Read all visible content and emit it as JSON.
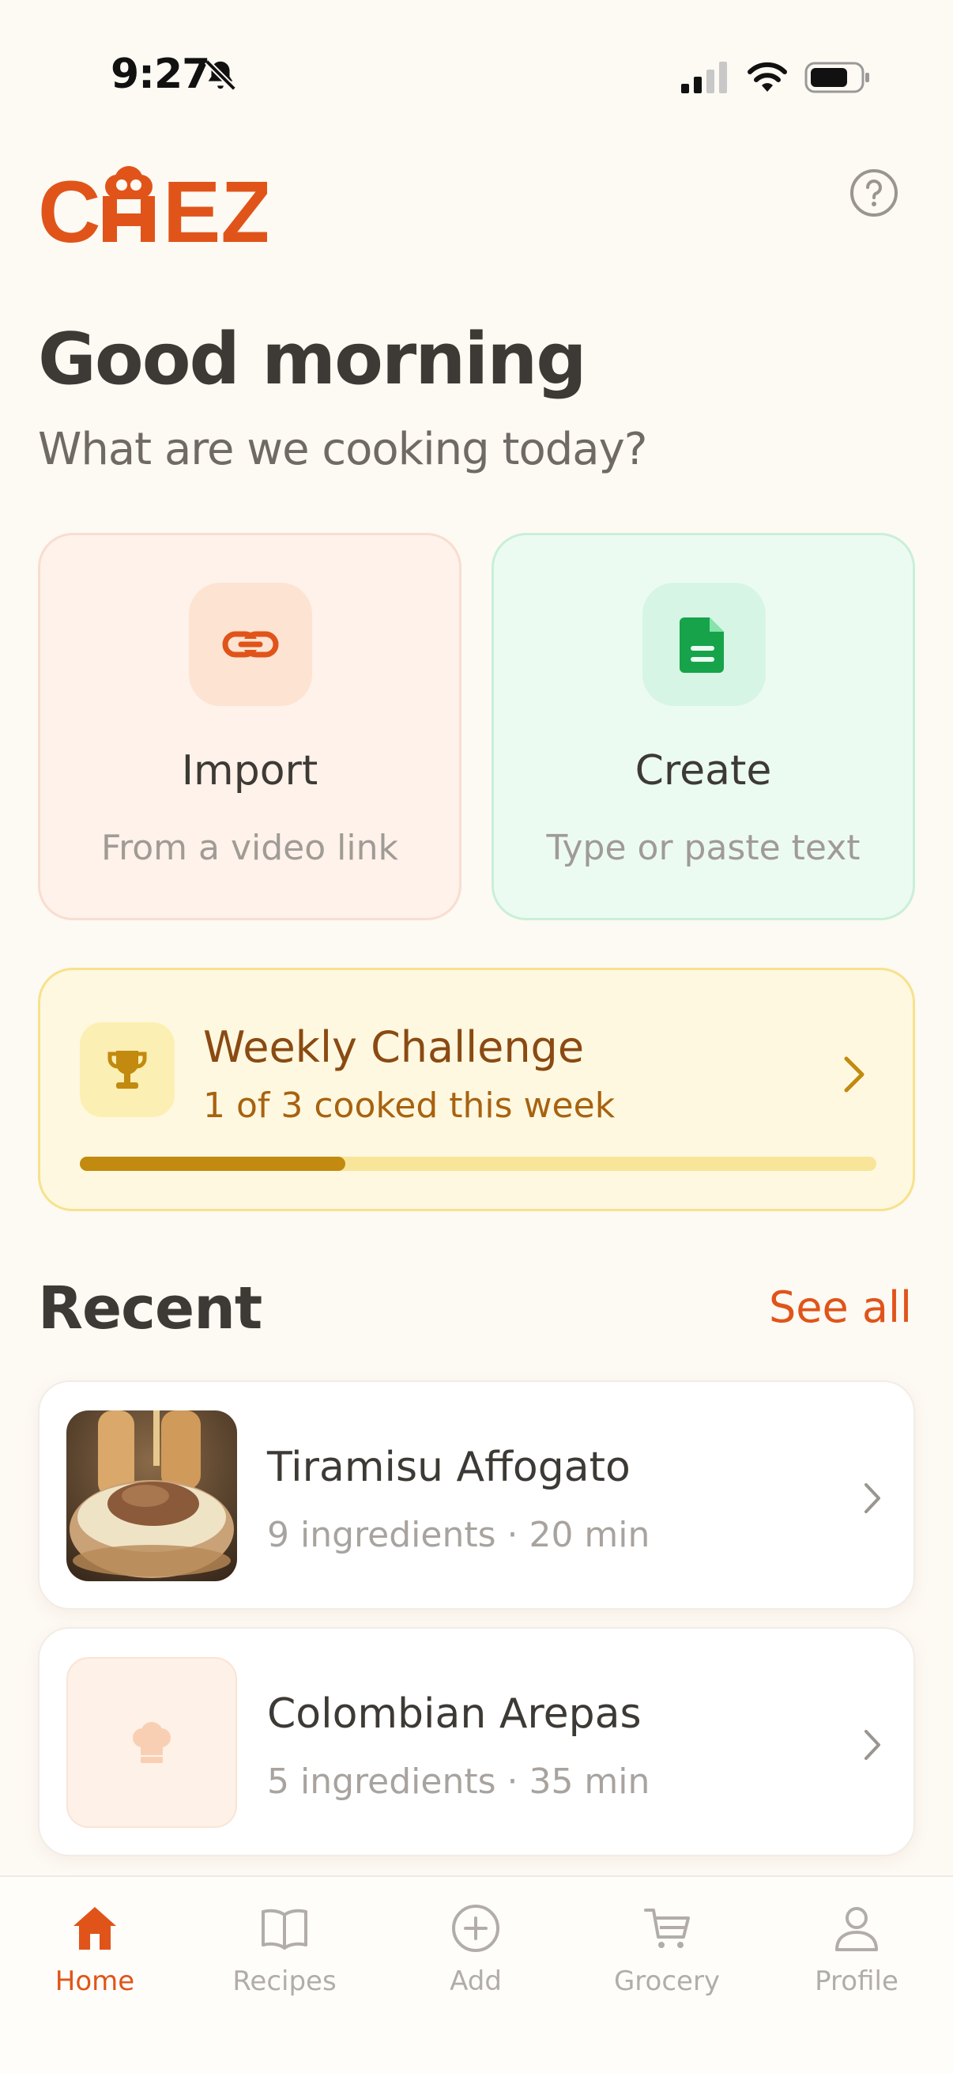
{
  "status_bar": {
    "time": "9:27"
  },
  "header": {
    "app_name": "CHEZ"
  },
  "greeting": {
    "title": "Good morning",
    "subtitle": "What are we cooking today?"
  },
  "actions": [
    {
      "title": "Import",
      "subtitle": "From a video link",
      "icon": "link-icon"
    },
    {
      "title": "Create",
      "subtitle": "Type or paste text",
      "icon": "document-icon"
    }
  ],
  "challenge": {
    "title": "Weekly Challenge",
    "progress_text": "1 of 3 cooked this week",
    "progress_fraction": 0.333
  },
  "recent": {
    "title": "Recent",
    "see_all": "See all",
    "items": [
      {
        "name": "Tiramisu Affogato",
        "meta": "9 ingredients · 20 min",
        "has_photo": true
      },
      {
        "name": "Colombian Arepas",
        "meta": "5 ingredients · 35 min",
        "has_photo": false
      }
    ]
  },
  "tabs": [
    {
      "label": "Home",
      "icon": "home-icon",
      "active": true
    },
    {
      "label": "Recipes",
      "icon": "book-icon",
      "active": false
    },
    {
      "label": "Add",
      "icon": "plus-circle-icon",
      "active": false
    },
    {
      "label": "Grocery",
      "icon": "cart-icon",
      "active": false
    },
    {
      "label": "Profile",
      "icon": "person-icon",
      "active": false
    }
  ],
  "colors": {
    "brand": "#e0541a",
    "background": "#fdf9f3",
    "import_card": "#fef2ea",
    "create_card": "#ecfbf2",
    "challenge_card": "#fef8e0",
    "progress_fill": "#c28a0e"
  }
}
